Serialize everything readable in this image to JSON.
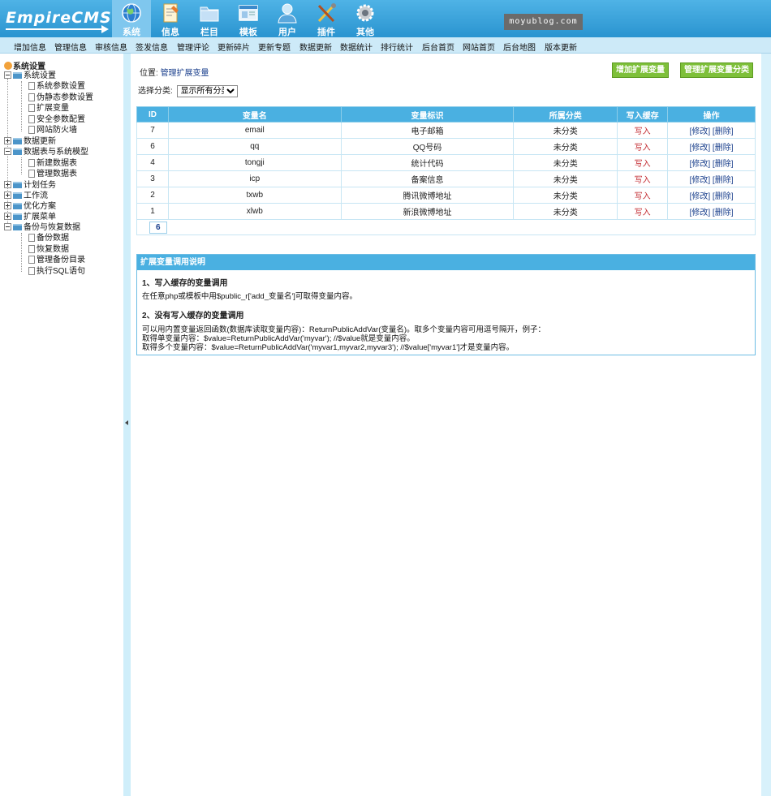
{
  "header": {
    "logo_text": "EmpireCMS",
    "site_badge": "moyublog.com",
    "nav": [
      {
        "label": "系统",
        "icon": "globe-icon",
        "active": true
      },
      {
        "label": "信息",
        "icon": "document-icon"
      },
      {
        "label": "栏目",
        "icon": "folder-icon"
      },
      {
        "label": "模板",
        "icon": "template-window-icon"
      },
      {
        "label": "用户",
        "icon": "user-icon"
      },
      {
        "label": "插件",
        "icon": "tools-icon"
      },
      {
        "label": "其他",
        "icon": "gear-icon"
      }
    ]
  },
  "submenu": [
    "增加信息",
    "管理信息",
    "审核信息",
    "签发信息",
    "管理评论",
    "更新碎片",
    "更新专题",
    "数据更新",
    "数据统计",
    "排行统计",
    "后台首页",
    "网站首页",
    "后台地图",
    "版本更新"
  ],
  "sidebar": {
    "root": "系统设置",
    "nodes": [
      {
        "label": "系统设置",
        "kind": "folder-open"
      },
      {
        "label": "系统参数设置",
        "kind": "page"
      },
      {
        "label": "伪静态参数设置",
        "kind": "page"
      },
      {
        "label": "扩展变量",
        "kind": "page"
      },
      {
        "label": "安全参数配置",
        "kind": "page"
      },
      {
        "label": "网站防火墙",
        "kind": "page"
      },
      {
        "label": "数据更新",
        "kind": "folder-closed"
      },
      {
        "label": "数据表与系统模型",
        "kind": "folder-open"
      },
      {
        "label": "新建数据表",
        "kind": "page"
      },
      {
        "label": "管理数据表",
        "kind": "page"
      },
      {
        "label": "计划任务",
        "kind": "folder-closed"
      },
      {
        "label": "工作流",
        "kind": "folder-closed"
      },
      {
        "label": "优化方案",
        "kind": "folder-closed"
      },
      {
        "label": "扩展菜单",
        "kind": "folder-closed"
      },
      {
        "label": "备份与恢复数据",
        "kind": "folder-open"
      },
      {
        "label": "备份数据",
        "kind": "page"
      },
      {
        "label": "恢复数据",
        "kind": "page"
      },
      {
        "label": "管理备份目录",
        "kind": "page"
      },
      {
        "label": "执行SQL语句",
        "kind": "page"
      }
    ]
  },
  "main": {
    "breadcrumb_prefix": "位置:",
    "breadcrumb_link": "管理扩展变量",
    "btn_add": "增加扩展变量",
    "btn_manage": "管理扩展变量分类",
    "filter_label": "选择分类:",
    "filter_value": "显示所有分类",
    "table": {
      "headers": [
        "ID",
        "变量名",
        "变量标识",
        "所属分类",
        "写入缓存",
        "操作"
      ],
      "rows": [
        {
          "id": "7",
          "name": "email",
          "label": "电子邮箱",
          "category": "未分类",
          "cache": "写入",
          "ops": "[修改] [删除]"
        },
        {
          "id": "6",
          "name": "qq",
          "label": "QQ号码",
          "category": "未分类",
          "cache": "写入",
          "ops": "[修改] [删除]"
        },
        {
          "id": "4",
          "name": "tongji",
          "label": "统计代码",
          "category": "未分类",
          "cache": "写入",
          "ops": "[修改] [删除]"
        },
        {
          "id": "3",
          "name": "icp",
          "label": "备案信息",
          "category": "未分类",
          "cache": "写入",
          "ops": "[修改] [删除]"
        },
        {
          "id": "2",
          "name": "txwb",
          "label": "腾讯微博地址",
          "category": "未分类",
          "cache": "写入",
          "ops": "[修改] [删除]"
        },
        {
          "id": "1",
          "name": "xlwb",
          "label": "新浪微博地址",
          "category": "未分类",
          "cache": "写入",
          "ops": "[修改] [删除]"
        }
      ],
      "page": "6"
    },
    "info": {
      "title": "扩展变量调用说明",
      "h1": "1、写入缓存的变量调用",
      "p1": "在任意php或模板中用$public_r['add_变量名']可取得变量内容。",
      "h2": "2、没有写入缓存的变量调用",
      "p2": "可以用内置变量返回函数(数据库读取变量内容)：ReturnPublicAddVar(变量名)。取多个变量内容可用逗号隔开，例子：",
      "p3": "取得单变量内容：$value=ReturnPublicAddVar('myvar'); //$value就是变量内容。",
      "p4": "取得多个变量内容：$value=ReturnPublicAddVar('myvar1,myvar2,myvar3'); //$value['myvar1']才是变量内容。"
    }
  }
}
